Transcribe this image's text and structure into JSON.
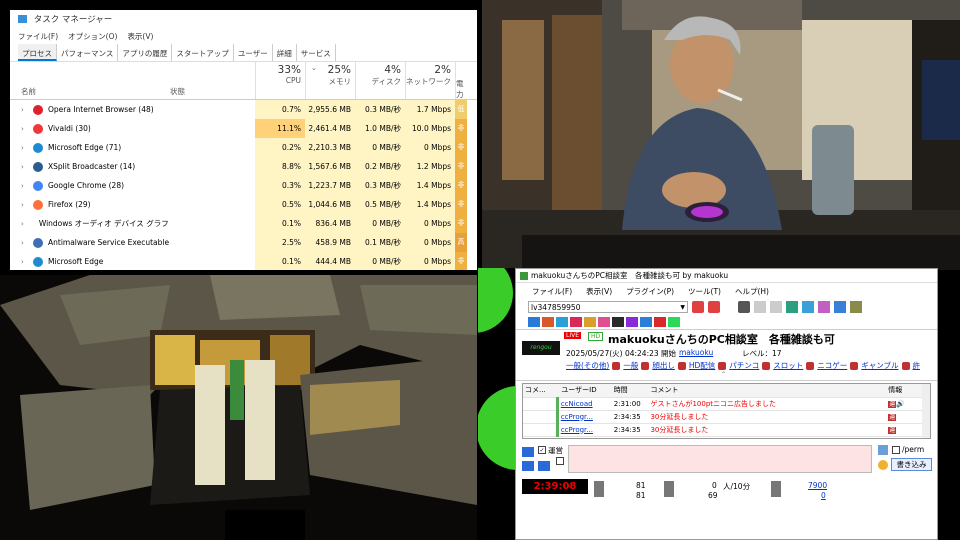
{
  "task_manager": {
    "title": "タスク マネージャー",
    "menu": [
      "ファイル(F)",
      "オプション(O)",
      "表示(V)"
    ],
    "tabs": [
      "プロセス",
      "パフォーマンス",
      "アプリの履歴",
      "スタートアップ",
      "ユーザー",
      "詳細",
      "サービス"
    ],
    "headers": {
      "name": "名前",
      "status": "状態",
      "cpu_pct": "33%",
      "cpu": "CPU",
      "mem_pct": "25%",
      "mem": "メモリ",
      "disk_pct": "4%",
      "disk": "ディスク",
      "net_pct": "2%",
      "net": "ネットワーク",
      "power": "電力"
    },
    "rows": [
      {
        "name": "Opera Internet Browser (48)",
        "cpu": "0.7%",
        "mem": "2,955.6 MB",
        "disk": "0.3 MB/秒",
        "net": "1.7 Mbps",
        "power": "低",
        "icon": "opera-icon",
        "color": "#e0202a"
      },
      {
        "name": "Vivaldi (30)",
        "cpu": "11.1%",
        "mem": "2,461.4 MB",
        "disk": "1.0 MB/秒",
        "net": "10.0 Mbps",
        "power": "非",
        "icon": "vivaldi-icon",
        "color": "#ef3939"
      },
      {
        "name": "Microsoft Edge (71)",
        "cpu": "0.2%",
        "mem": "2,210.3 MB",
        "disk": "0 MB/秒",
        "net": "0 Mbps",
        "power": "非",
        "icon": "edge-icon",
        "color": "#1f8ad2"
      },
      {
        "name": "XSplit Broadcaster (14)",
        "cpu": "8.8%",
        "mem": "1,567.6 MB",
        "disk": "0.2 MB/秒",
        "net": "1.2 Mbps",
        "power": "非",
        "icon": "xsplit-icon",
        "color": "#2a5d8f"
      },
      {
        "name": "Google Chrome (28)",
        "cpu": "0.3%",
        "mem": "1,223.7 MB",
        "disk": "0.3 MB/秒",
        "net": "1.4 Mbps",
        "power": "非",
        "icon": "chrome-icon",
        "color": "#4285f4"
      },
      {
        "name": "Firefox (29)",
        "cpu": "0.5%",
        "mem": "1,044.6 MB",
        "disk": "0.5 MB/秒",
        "net": "1.4 Mbps",
        "power": "非",
        "icon": "firefox-icon",
        "color": "#ff7139"
      },
      {
        "name": "Windows オーディオ デバイス グラフ ...",
        "cpu": "0.1%",
        "mem": "836.4 MB",
        "disk": "0 MB/秒",
        "net": "0 Mbps",
        "power": "非",
        "icon": "",
        "color": ""
      },
      {
        "name": "Antimalware Service Executable",
        "cpu": "2.5%",
        "mem": "458.9 MB",
        "disk": "0.1 MB/秒",
        "net": "0 Mbps",
        "power": "高",
        "icon": "shield-icon",
        "color": "#3d6fb5"
      },
      {
        "name": "Microsoft Edge",
        "cpu": "0.1%",
        "mem": "444.4 MB",
        "disk": "0 MB/秒",
        "net": "0 Mbps",
        "power": "非",
        "icon": "edge-icon",
        "color": "#1f8ad2"
      }
    ]
  },
  "nico": {
    "title": "makuokuさんちのPC相談室　各種雑談も可 by makuoku",
    "menu": [
      "ファイル(F)",
      "表示(V)",
      "プラグイン(P)",
      "ツール(T)",
      "ヘルプ(H)"
    ],
    "lv": "lv347859950",
    "live_badge": "LIVE",
    "hd_badge": "HD",
    "logo_text": "rengou",
    "broadcast_title": "makuokuさんちのPC相談室　各種雑談も可",
    "start": "2025/05/27(火) 04:24:23 開始",
    "owner": "makuoku",
    "level": "レベル：17",
    "tags": [
      "一般(その他)",
      "一般",
      "顔出し",
      "HD配信",
      "パチンコ",
      "スロット",
      "ニコゲー",
      "ギャンブル",
      "許"
    ],
    "comment_headers": [
      "コメ...",
      "ユーザーID",
      "時間",
      "コメント",
      "情報"
    ],
    "comments": [
      {
        "user": "ccNicoad",
        "time": "2:31:00",
        "text": "ゲストさんが100ptニコニ広告しました",
        "info": "運"
      },
      {
        "user": "ccProgr...",
        "time": "2:34:35",
        "text": "30分延長しました",
        "info": "運"
      },
      {
        "user": "ccProgr...",
        "time": "2:34:35",
        "text": "30分延長しました",
        "info": "運"
      }
    ],
    "unei_label": "運営",
    "perm_label": "/perm",
    "submit_label": "書き込み",
    "timer": "2:39:08",
    "stats": {
      "visitors_a": "81",
      "visitors_b": "81",
      "comments_a": "0",
      "comments_b": "69",
      "rate_unit": "人/10分",
      "points_a": "7900",
      "points_b": "0"
    }
  }
}
